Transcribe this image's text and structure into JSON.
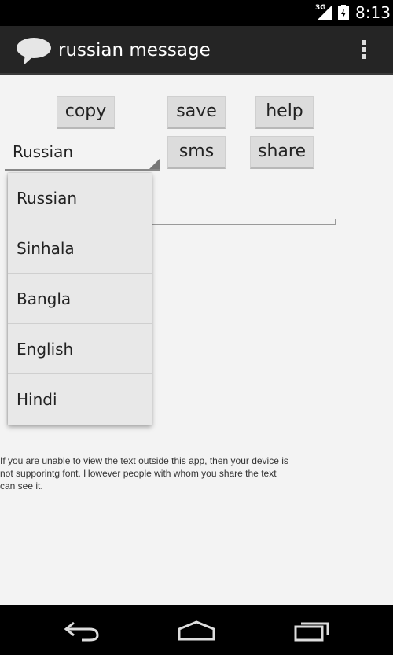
{
  "status_bar": {
    "network": "3G",
    "time": "8:13"
  },
  "action_bar": {
    "title": "russian message",
    "app_icon": "speech-bubble-icon",
    "overflow_icon": "overflow-menu-icon"
  },
  "buttons": {
    "copy": "copy",
    "save": "save",
    "help": "help",
    "sms": "sms",
    "share": "share"
  },
  "language_spinner": {
    "selected": "Russian"
  },
  "dropdown": {
    "options": [
      "Russian",
      "Sinhala",
      "Bangla",
      "English",
      "Hindi"
    ]
  },
  "info_text": "If you are unable to view the text outside this app, then your device is not supporintg font. However people with whom you share the text can see it.",
  "nav_bar": {
    "back_icon": "back-icon",
    "home_icon": "home-icon",
    "recents_icon": "recents-icon"
  }
}
